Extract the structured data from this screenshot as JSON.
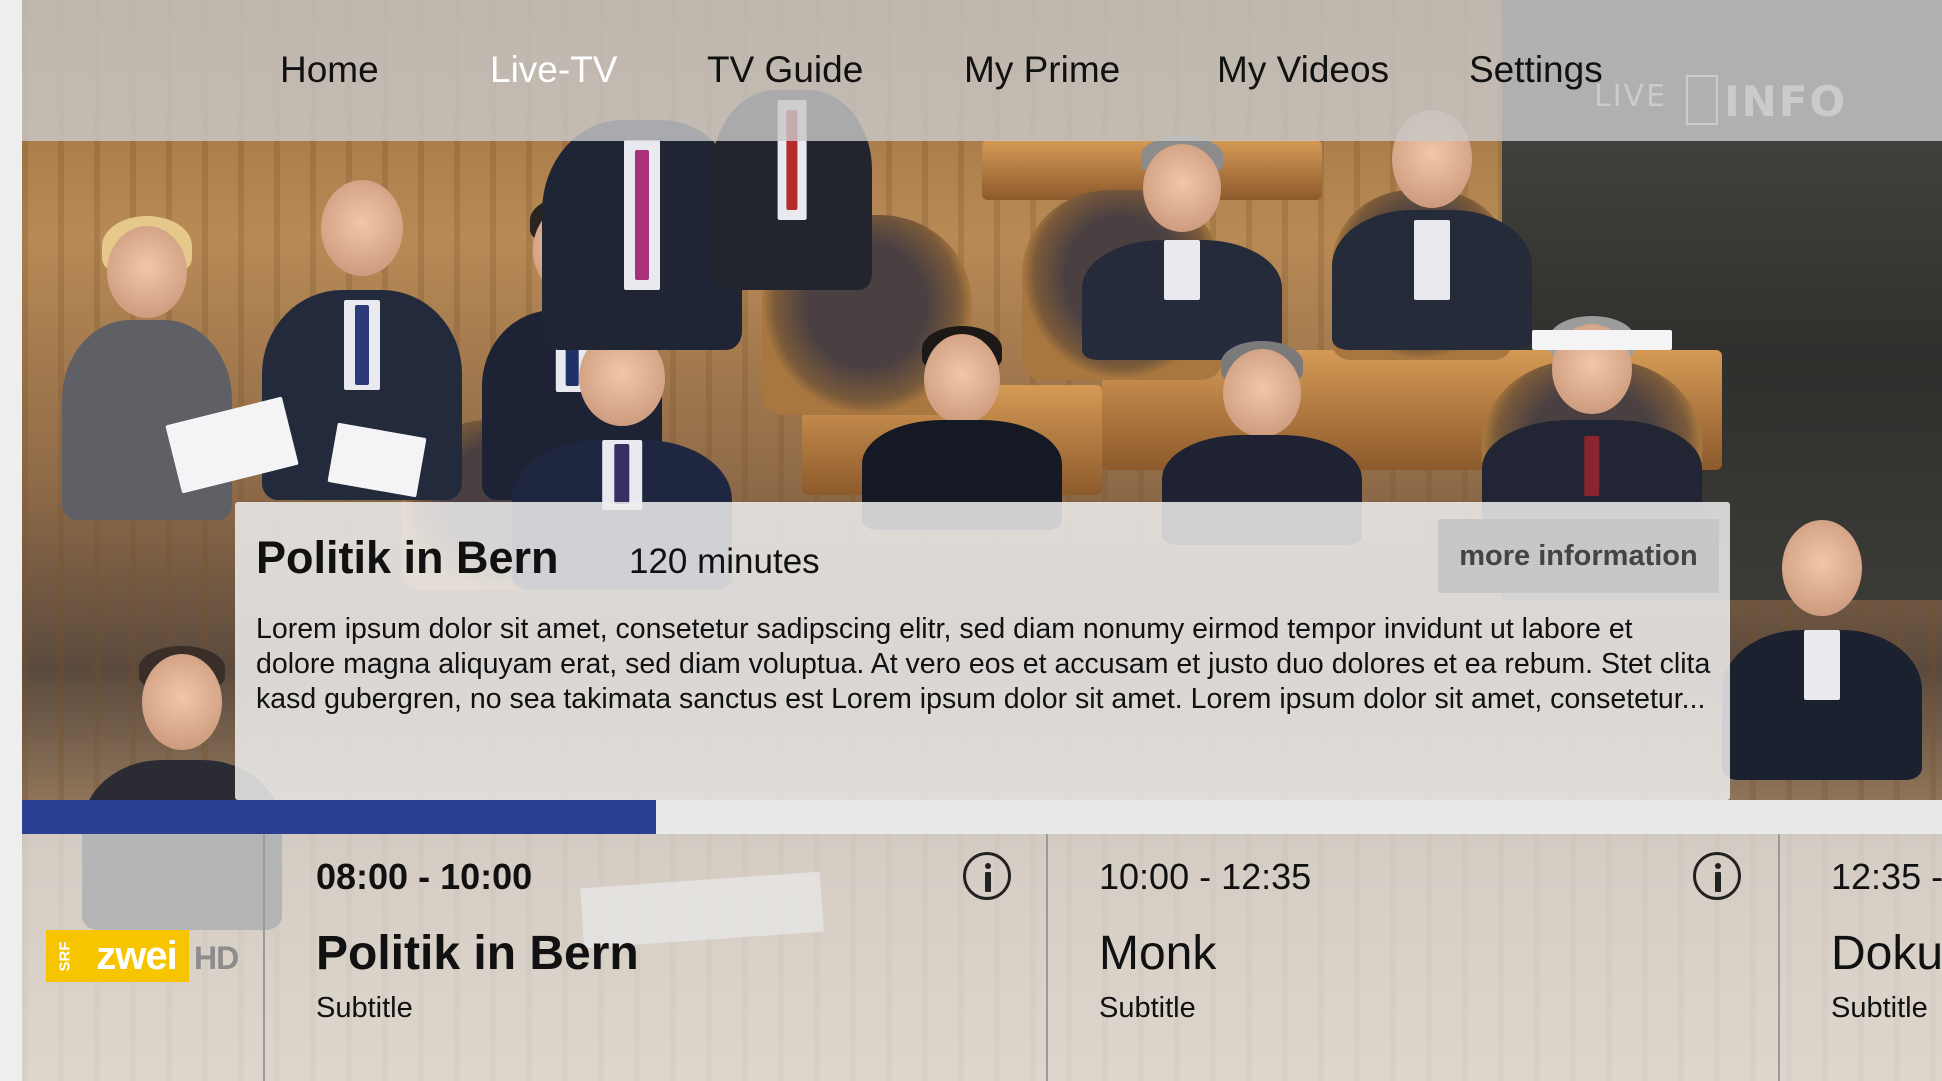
{
  "nav": {
    "items": [
      {
        "label": "Home",
        "active": false
      },
      {
        "label": "Live-TV",
        "active": true
      },
      {
        "label": "TV Guide",
        "active": false
      },
      {
        "label": "My Prime",
        "active": false
      },
      {
        "label": "My Videos",
        "active": false
      },
      {
        "label": "Settings",
        "active": false
      }
    ]
  },
  "watermark": {
    "live": "LIVE",
    "srf": "SRF",
    "info": "INFO"
  },
  "current": {
    "title": "Politik in Bern",
    "duration": "120 minutes",
    "more_button": "more information",
    "description": "Lorem ipsum dolor sit amet, consetetur sadipscing elitr, sed diam nonumy eirmod tempor invidunt ut labore et dolore magna aliquyam erat, sed diam voluptua. At vero eos et accusam et justo duo dolores et ea rebum. Stet clita kasd gubergren, no sea takimata sanctus est Lorem ipsum dolor sit amet. Lorem ipsum dolor sit amet, consetetur..."
  },
  "progress": {
    "fraction": 0.33,
    "fill_color": "#2b3f93"
  },
  "channel": {
    "logo_srf": "SRF",
    "logo_name": "zwei",
    "logo_hd": "HD",
    "brand_color": "#f6c500"
  },
  "guide": {
    "programs": [
      {
        "time": "08:00 - 10:00",
        "title": "Politik in Bern",
        "subtitle": "Subtitle",
        "current": true,
        "info_icon": "info-icon"
      },
      {
        "time": "10:00 - 12:35",
        "title": "Monk",
        "subtitle": "Subtitle",
        "current": false,
        "info_icon": "info-icon"
      },
      {
        "time": "12:35 -",
        "title": "Doku",
        "subtitle": "Subtitle",
        "current": false
      }
    ]
  }
}
